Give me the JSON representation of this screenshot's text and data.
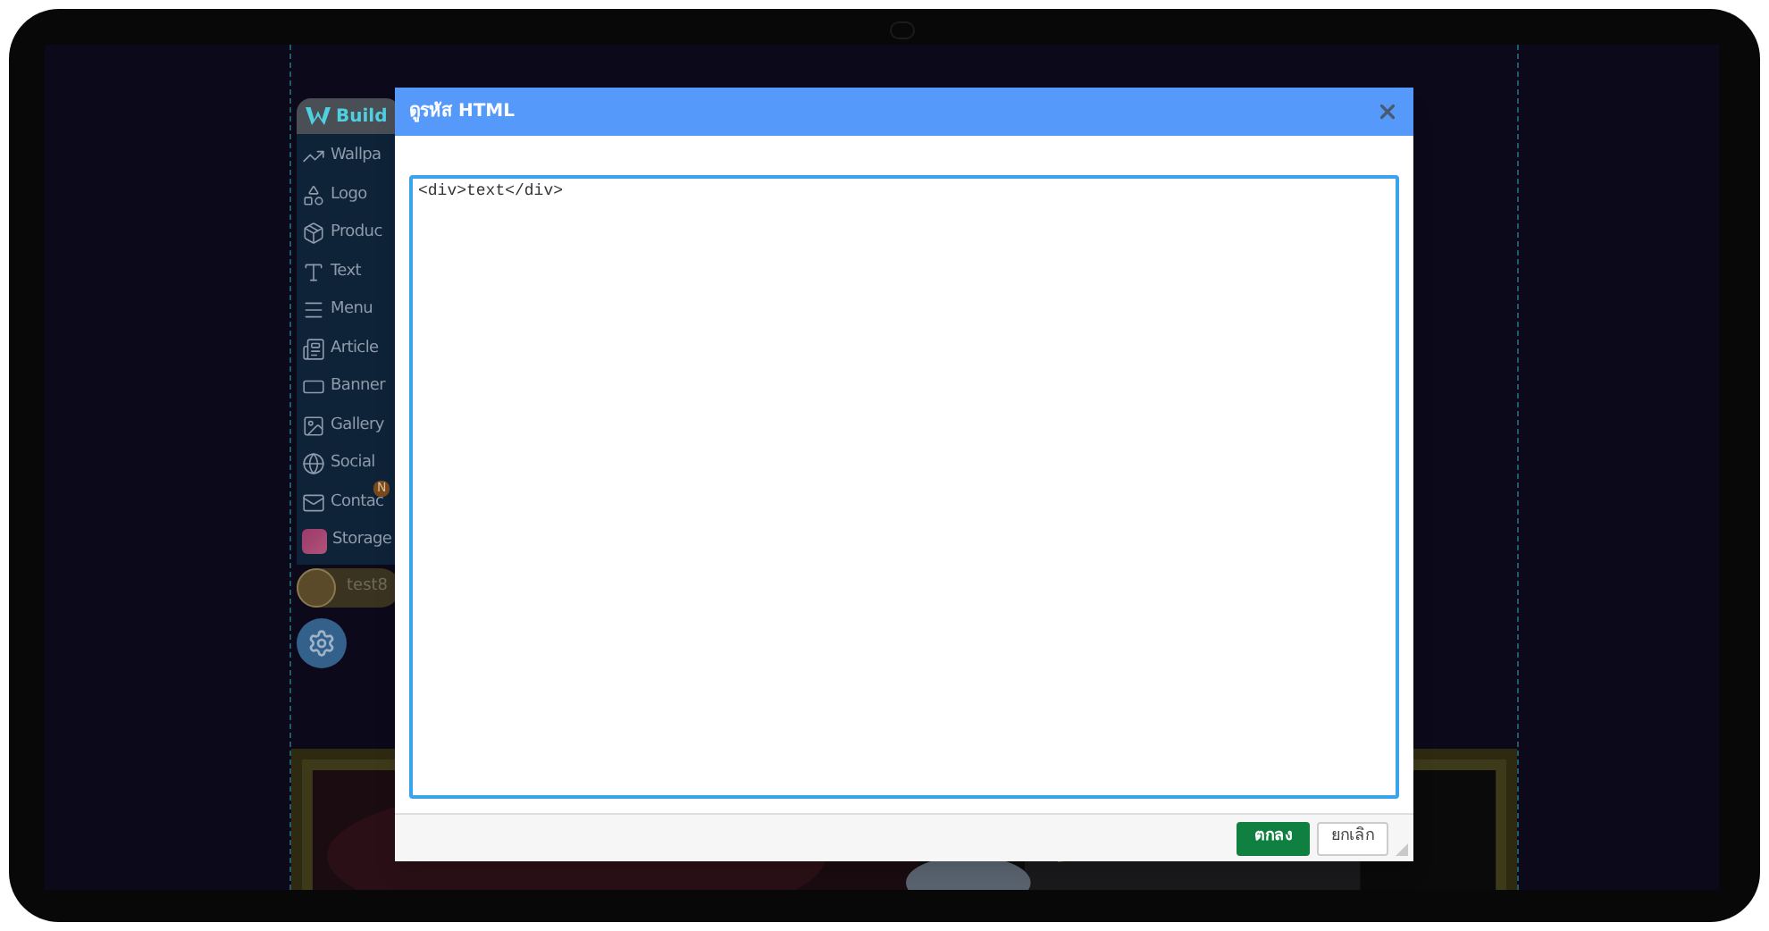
{
  "sidebar": {
    "brand": "Build",
    "items": [
      {
        "label": "Wallpa",
        "kind": "wallpaper"
      },
      {
        "label": "Logo",
        "kind": "logo"
      },
      {
        "label": "Produc",
        "kind": "product"
      },
      {
        "label": "Text",
        "kind": "text"
      },
      {
        "label": "Menu",
        "kind": "menu"
      },
      {
        "label": "Article",
        "kind": "article"
      },
      {
        "label": "Banner",
        "kind": "banner"
      },
      {
        "label": "Gallery",
        "kind": "gallery"
      },
      {
        "label": "Social",
        "kind": "social"
      },
      {
        "label": "Contac",
        "kind": "contact",
        "badge": "N"
      },
      {
        "label": "Storage",
        "kind": "storage"
      }
    ],
    "user": {
      "name": "test8"
    }
  },
  "dialog": {
    "title": "ดูรหัส HTML",
    "code": "<div>text</div>",
    "buttons": [
      {
        "label": "ตกลง",
        "kind": "primary"
      },
      {
        "label": "ยกเลิก",
        "kind": "secondary"
      }
    ]
  }
}
